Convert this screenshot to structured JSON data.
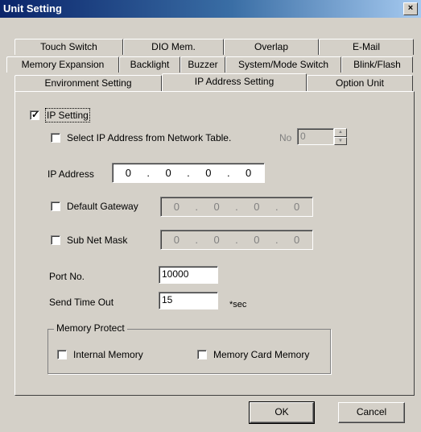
{
  "window": {
    "title": "Unit Setting",
    "close_label": "×"
  },
  "tabs": {
    "row1": [
      "Touch Switch",
      "DIO Mem.",
      "Overlap",
      "E-Mail"
    ],
    "row2": [
      "Memory Expansion",
      "Backlight",
      "Buzzer",
      "System/Mode Switch",
      "Blink/Flash"
    ],
    "row3": [
      "Environment Setting",
      "IP Address Setting",
      "Option Unit"
    ],
    "active": "IP Address Setting"
  },
  "ip_setting": {
    "label": "IP Setting",
    "checked": true
  },
  "select_from_table": {
    "label": "Select IP Address from Network Table.",
    "checked": false,
    "no_label": "No",
    "no_value": "0"
  },
  "ip_address": {
    "label": "IP Address",
    "octets": [
      "0",
      "0",
      "0",
      "0"
    ]
  },
  "default_gateway": {
    "label": "Default Gateway",
    "checked": false,
    "octets": [
      "0",
      "0",
      "0",
      "0"
    ]
  },
  "subnet_mask": {
    "label": "Sub Net Mask",
    "checked": false,
    "octets": [
      "0",
      "0",
      "0",
      "0"
    ]
  },
  "port": {
    "label": "Port No.",
    "value": "10000"
  },
  "timeout": {
    "label": "Send Time Out",
    "value": "15",
    "unit": "*sec"
  },
  "memory_protect": {
    "title": "Memory Protect",
    "internal": {
      "label": "Internal Memory",
      "checked": false
    },
    "card": {
      "label": "Memory Card Memory",
      "checked": false
    }
  },
  "buttons": {
    "ok": "OK",
    "cancel": "Cancel"
  }
}
